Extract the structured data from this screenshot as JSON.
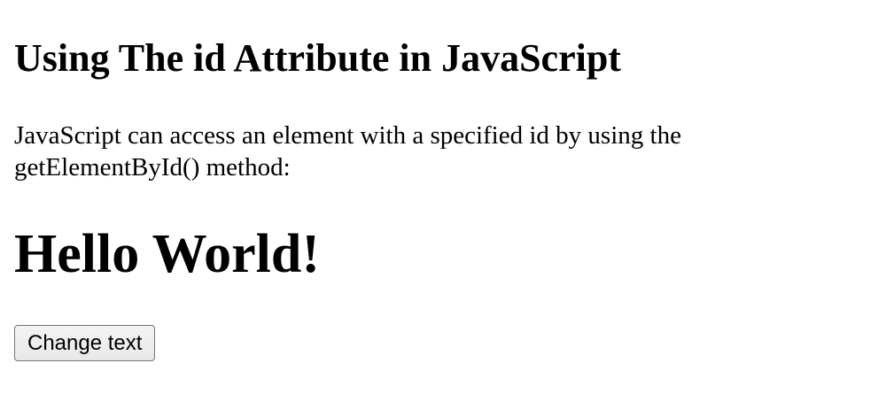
{
  "page": {
    "heading": "Using The id Attribute in JavaScript",
    "description": "JavaScript can access an element with a specified id by using the getElementById() method:",
    "demo_text": "Hello World!",
    "button_label": "Change text"
  }
}
